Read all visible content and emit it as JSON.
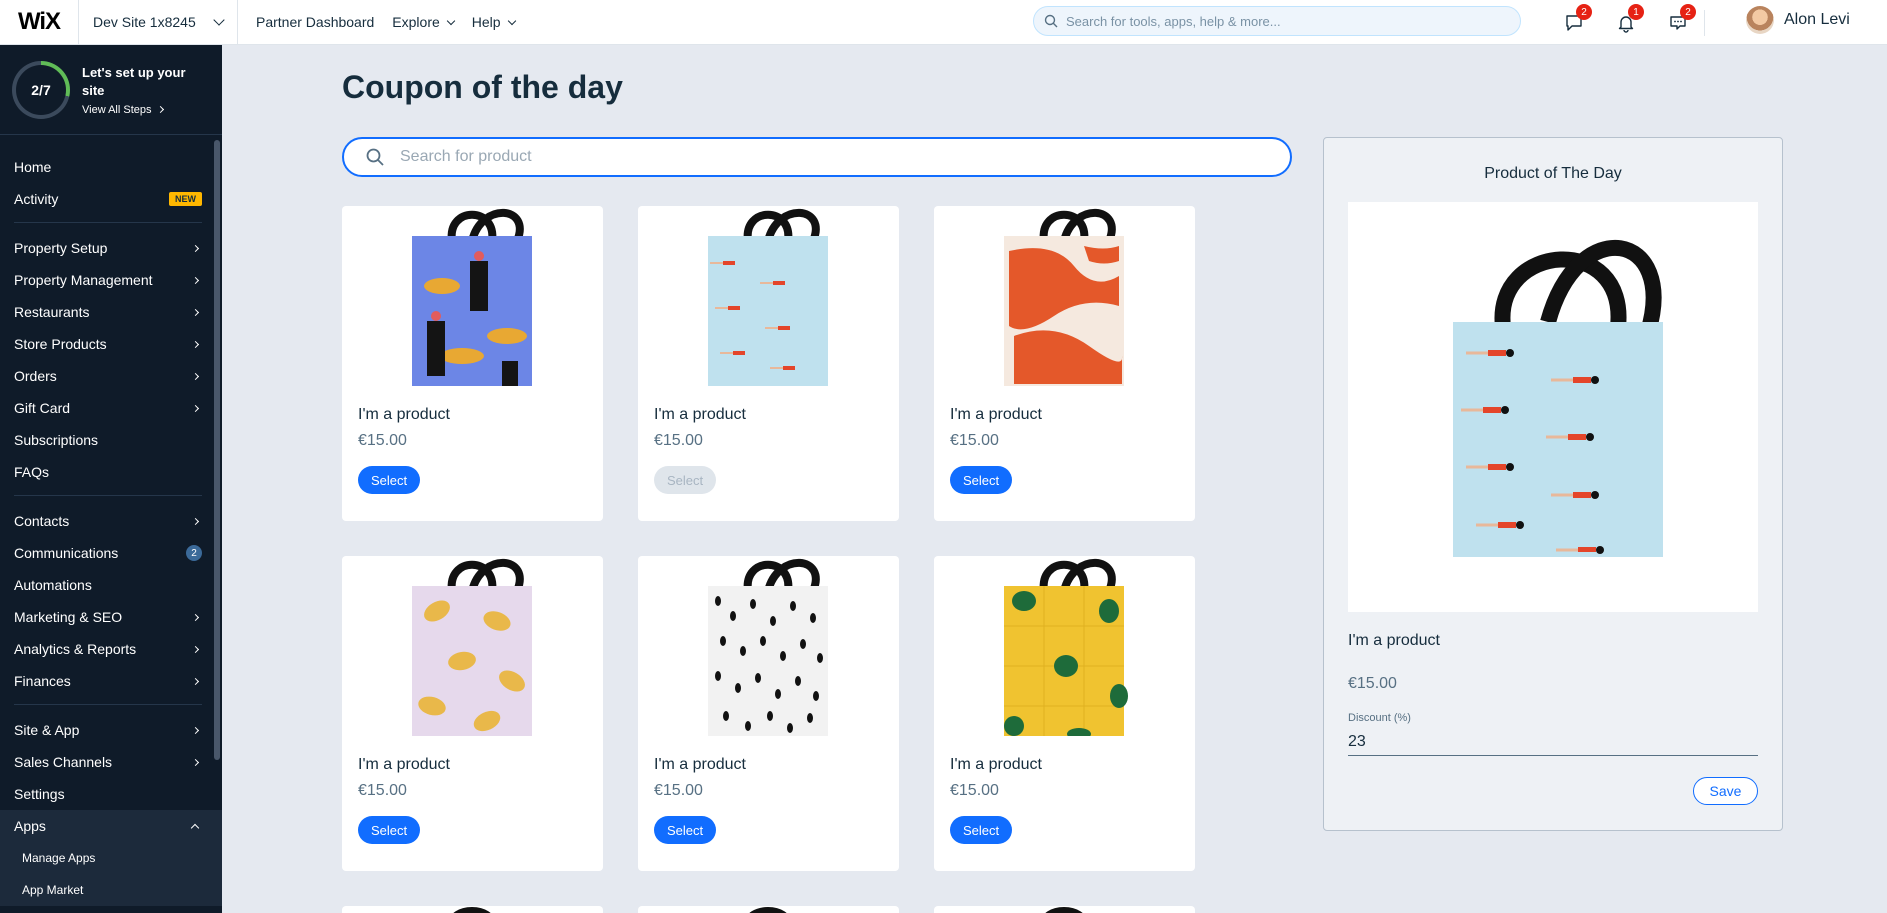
{
  "topbar": {
    "logo": "WiX",
    "site_name": "Dev Site 1x8245",
    "nav": [
      "Partner Dashboard",
      "Explore",
      "Help"
    ],
    "search_placeholder": "Search for tools, apps, help & more...",
    "badges": {
      "chat": "2",
      "notifications": "1",
      "messages": "2"
    },
    "user_name": "Alon Levi"
  },
  "setup": {
    "progress": "2/7",
    "title": "Let's set up your site",
    "link": "View All Steps"
  },
  "sidebar": {
    "items": [
      {
        "label": "Home"
      },
      {
        "label": "Activity",
        "badge": "NEW"
      },
      {
        "label": "Property Setup"
      },
      {
        "label": "Property Management"
      },
      {
        "label": "Restaurants"
      },
      {
        "label": "Store Products"
      },
      {
        "label": "Orders"
      },
      {
        "label": "Gift Card"
      },
      {
        "label": "Subscriptions"
      },
      {
        "label": "FAQs"
      },
      {
        "label": "Contacts"
      },
      {
        "label": "Communications",
        "count": "2"
      },
      {
        "label": "Automations"
      },
      {
        "label": "Marketing & SEO"
      },
      {
        "label": "Analytics & Reports"
      },
      {
        "label": "Finances"
      },
      {
        "label": "Site & App"
      },
      {
        "label": "Sales Channels"
      },
      {
        "label": "Settings"
      },
      {
        "label": "Apps"
      }
    ],
    "sub_items": [
      "Manage Apps",
      "App Market"
    ]
  },
  "main": {
    "title": "Coupon of the day",
    "search_placeholder": "Search for product",
    "products": [
      {
        "name": "I'm a product",
        "price": "€15.00",
        "button": "Select",
        "pattern": "tigers-blue"
      },
      {
        "name": "I'm a product",
        "price": "€15.00",
        "button": "Select",
        "pattern": "swimmers",
        "disabled": true
      },
      {
        "name": "I'm a product",
        "price": "€15.00",
        "button": "Select",
        "pattern": "orange-abstract"
      },
      {
        "name": "I'm a product",
        "price": "€15.00",
        "button": "Select",
        "pattern": "lemons"
      },
      {
        "name": "I'm a product",
        "price": "€15.00",
        "button": "Select",
        "pattern": "dalmatian"
      },
      {
        "name": "I'm a product",
        "price": "€15.00",
        "button": "Select",
        "pattern": "monstera"
      }
    ]
  },
  "product_of_day": {
    "title": "Product of The Day",
    "name": "I'm a product",
    "price": "€15.00",
    "discount_label": "Discount (%)",
    "discount_value": "23",
    "save_label": "Save"
  },
  "colors": {
    "accent": "#116dff",
    "sidebar": "#0f1b29",
    "background": "#e5e9f0"
  }
}
